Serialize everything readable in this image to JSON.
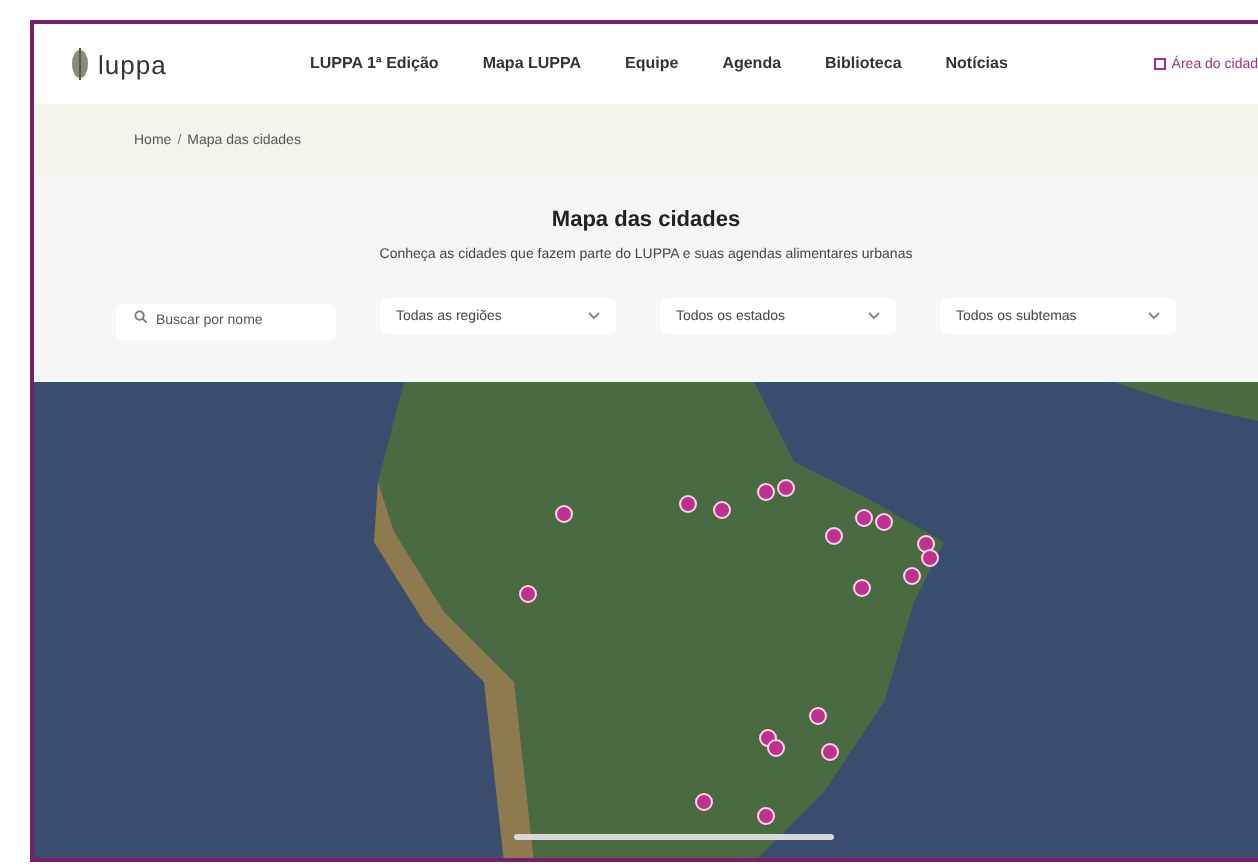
{
  "header": {
    "logo": "luppa",
    "nav": [
      {
        "label": "LUPPA 1ª Edição",
        "selected": false
      },
      {
        "label": "Mapa LUPPA",
        "selected": false
      },
      {
        "label": "Equipe",
        "selected": false
      },
      {
        "label": "Agenda",
        "selected": false
      },
      {
        "label": "Biblioteca",
        "selected": false
      },
      {
        "label": "Notícias",
        "selected": false
      }
    ],
    "account_link": "Área do cidad"
  },
  "breadcrumb": {
    "separator": "/",
    "items": [
      "Home",
      "Mapa das cidades"
    ]
  },
  "intro": {
    "title": "Mapa das cidades",
    "subtitle": "Conheça as cidades que fazem parte do LUPPA e suas agendas alimentares urbanas"
  },
  "filters": [
    {
      "kind": "search",
      "placeholder": "Buscar por nome"
    },
    {
      "kind": "select",
      "value": "Todas as regiões"
    },
    {
      "kind": "select",
      "value": "Todos os estados"
    },
    {
      "kind": "select",
      "value": "Todos os subtemas"
    }
  ]
}
